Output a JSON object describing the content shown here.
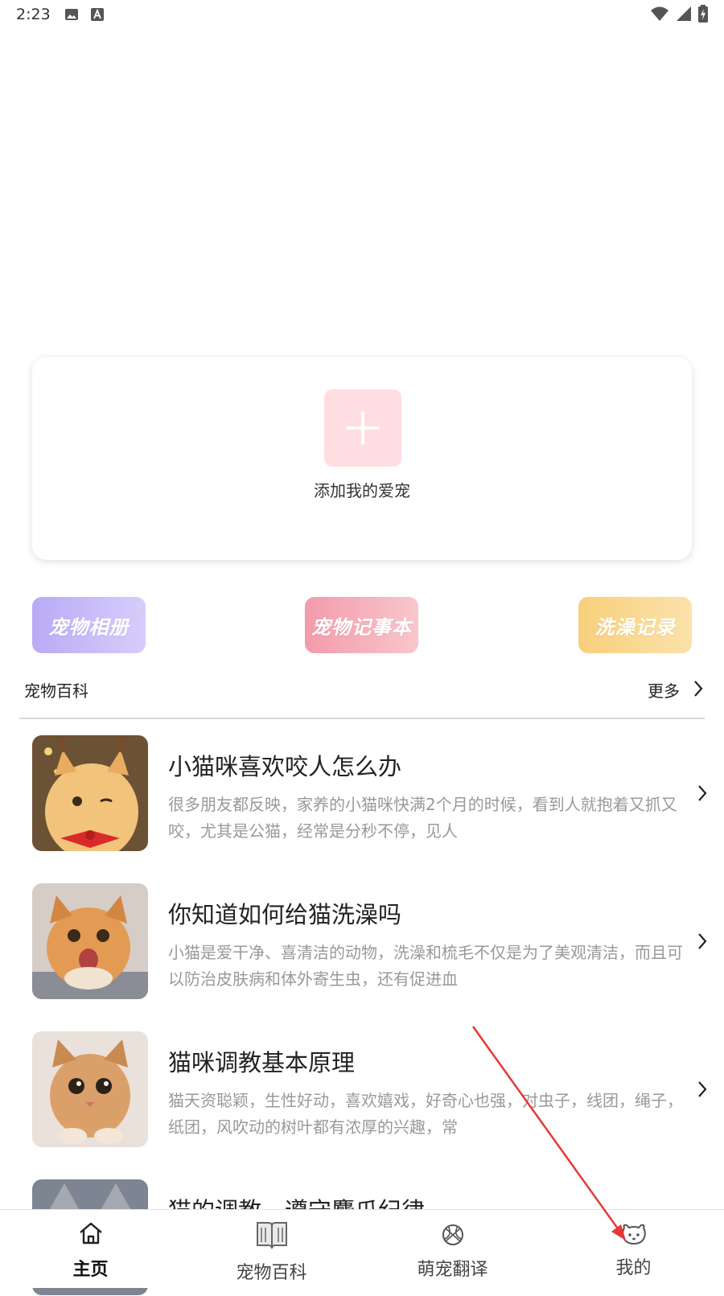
{
  "status_bar": {
    "time": "2:23"
  },
  "add_pet": {
    "label": "添加我的爱宠"
  },
  "quick_actions": [
    {
      "label": "宠物相册"
    },
    {
      "label": "宠物记事本"
    },
    {
      "label": "洗澡记录"
    }
  ],
  "section": {
    "title": "宠物百科",
    "more": "更多"
  },
  "articles": [
    {
      "title": "小猫咪喜欢咬人怎么办",
      "desc": "很多朋友都反映，家养的小猫咪快满2个月的时候，看到人就抱着又抓又咬，尤其是公猫，经常是分秒不停，见人"
    },
    {
      "title": "你知道如何给猫洗澡吗",
      "desc": "小猫是爱干净、喜清洁的动物，洗澡和梳毛不仅是为了美观清洁，而且可以防治皮肤病和体外寄生虫，还有促进血"
    },
    {
      "title": "猫咪调教基本原理",
      "desc": "猫天资聪颖，生性好动，喜欢嬉戏，好奇心也强，对虫子，线团，绳子，纸团，风吹动的树叶都有浓厚的兴趣，常"
    },
    {
      "title": "猫的调教，遵守麝爪纪律",
      "desc": ""
    }
  ],
  "bottom_nav": [
    {
      "label": "主页",
      "icon": "home-icon"
    },
    {
      "label": "宠物百科",
      "icon": "book-icon"
    },
    {
      "label": "萌宠翻译",
      "icon": "ball-icon"
    },
    {
      "label": "我的",
      "icon": "pet-face-icon"
    }
  ],
  "colors": {
    "accent": "#e53935",
    "add_bg": "#ffdde0"
  }
}
